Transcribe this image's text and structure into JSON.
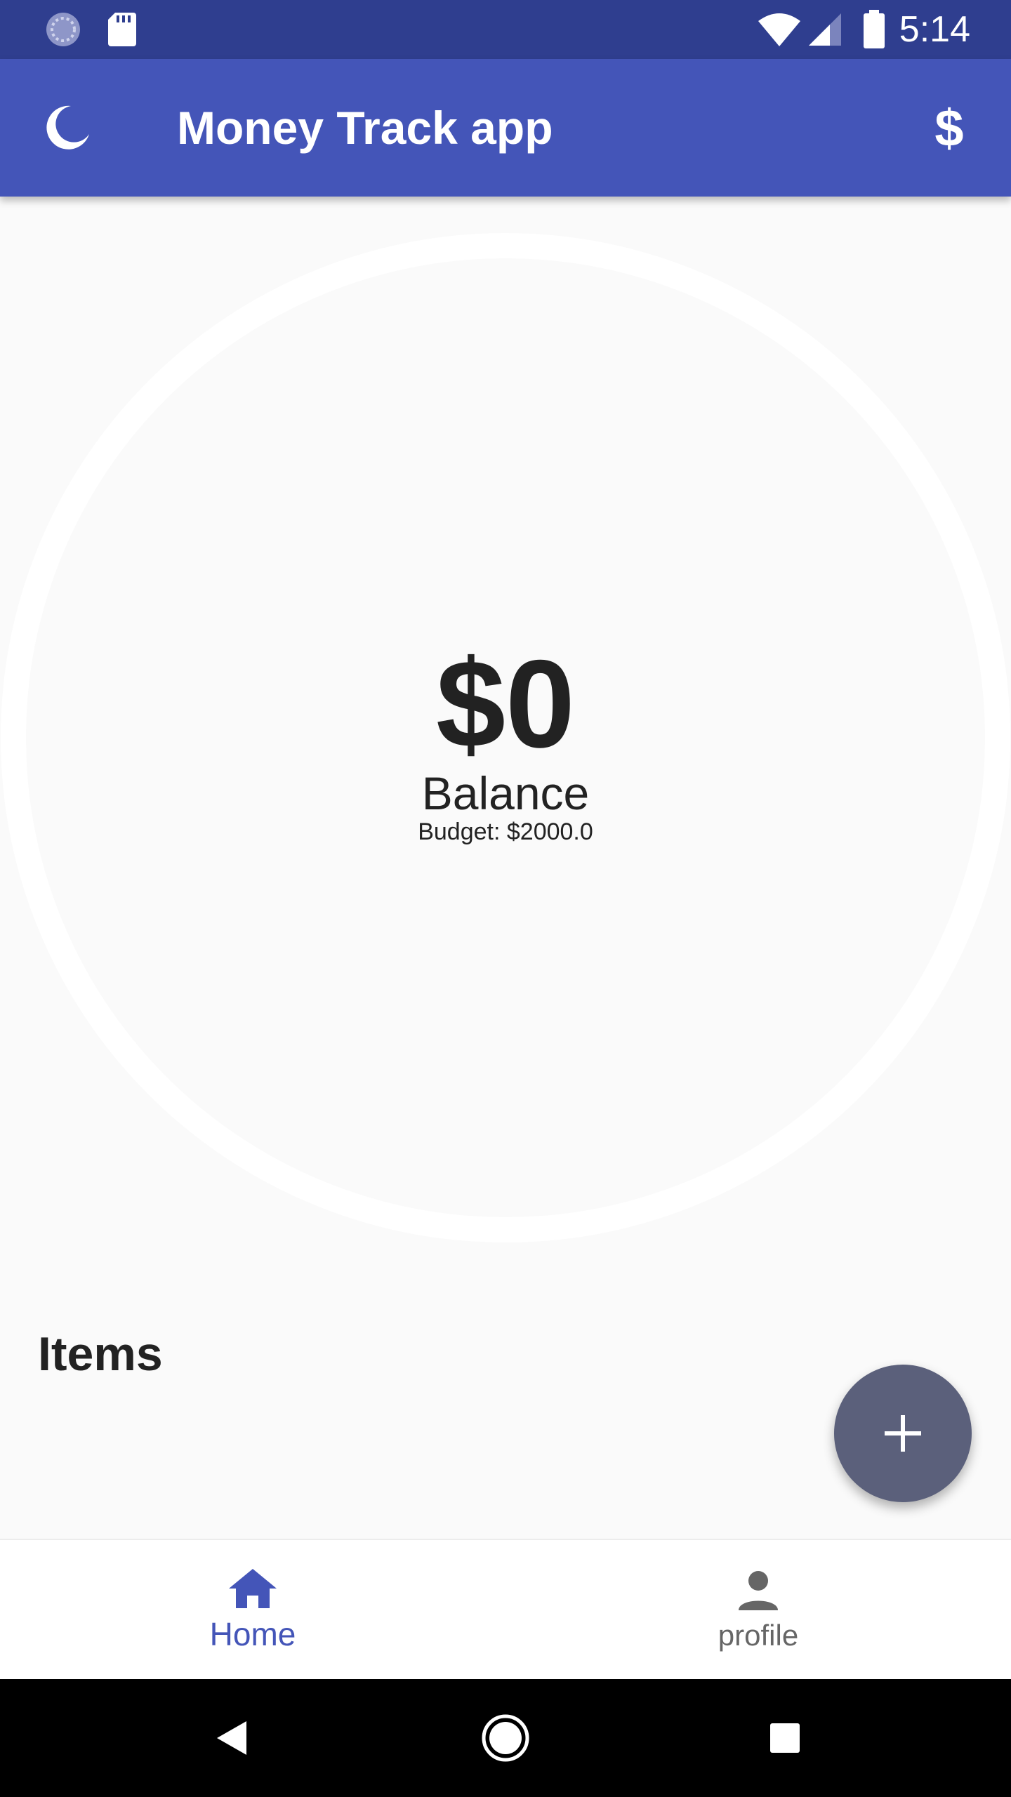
{
  "status_bar": {
    "time": "5:14",
    "icons": [
      "sync-icon",
      "sd-card-icon",
      "wifi-icon",
      "signal-icon",
      "battery-icon"
    ]
  },
  "app_bar": {
    "title": "Money Track app",
    "left_icon": "moon-icon",
    "right_action": "$"
  },
  "balance": {
    "amount": "$0",
    "label": "Balance",
    "budget": "Budget: $2000.0"
  },
  "items": {
    "heading": "Items"
  },
  "fab": {
    "icon": "plus-icon"
  },
  "bottom_nav": {
    "items": [
      {
        "label": "Home",
        "icon": "home-icon",
        "active": true
      },
      {
        "label": "profile",
        "icon": "person-icon",
        "active": false
      }
    ],
    "active_color": "#4455b8",
    "inactive_color": "#666666"
  },
  "colors": {
    "status_bar": "#2f3e8f",
    "app_bar": "#4455b8",
    "fab": "#5b607b",
    "background": "#fafafa"
  }
}
